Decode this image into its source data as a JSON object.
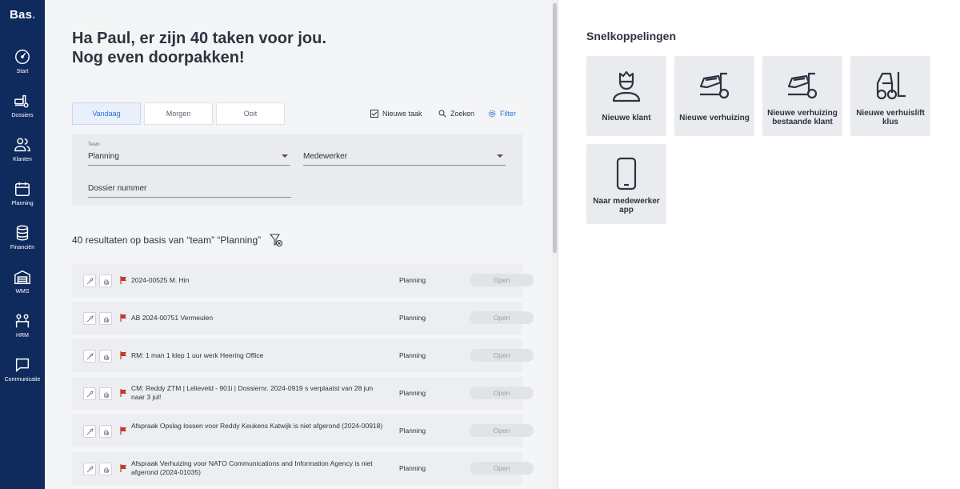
{
  "app": {
    "logo": "Bas",
    "logo_dot": "."
  },
  "sidebar": {
    "items": [
      {
        "label": "Start",
        "icon": "speedometer-icon"
      },
      {
        "label": "Dossiers",
        "icon": "moving-truck-icon"
      },
      {
        "label": "Klanten",
        "icon": "users-icon"
      },
      {
        "label": "Planning",
        "icon": "calendar-icon"
      },
      {
        "label": "Financiën",
        "icon": "coins-icon"
      },
      {
        "label": "WMS",
        "icon": "warehouse-icon"
      },
      {
        "label": "HRM",
        "icon": "people-board-icon"
      },
      {
        "label": "Communicatie",
        "icon": "chat-icon"
      }
    ]
  },
  "main": {
    "greeting_line1": "Ha Paul, er zijn 40 taken voor jou.",
    "greeting_line2": "Nog even doorpakken!",
    "tabs": [
      {
        "label": "Vandaag",
        "active": true
      },
      {
        "label": "Morgen",
        "active": false
      },
      {
        "label": "Ooit",
        "active": false
      }
    ],
    "actions": {
      "new_task": "Nieuwe taak",
      "search": "Zoeken",
      "filter": "Filter"
    },
    "filters": {
      "team_label": "Team",
      "team_value": "Planning",
      "employee_value": "Medewerker",
      "dossier_value": "Dossier nummer"
    },
    "results_text": "40 resultaten op basis van “team” “Planning”",
    "tasks": [
      {
        "description": "2024-00525 M. Hin",
        "team": "Planning",
        "status": "Open"
      },
      {
        "description": "AB 2024-00751 Vermeulen",
        "team": "Planning",
        "status": "Open"
      },
      {
        "description": "RM: 1 man 1 klep 1 uur werk Heering Office",
        "team": "Planning",
        "status": "Open"
      },
      {
        "description": "CM: Reddy ZTM | Lelieveld - 901i | Dossiernr. 2024-0919 s verplaatst van 28 jun naar 3 jul!",
        "team": "Planning",
        "status": "Open"
      },
      {
        "description": "Afspraak Opslag lossen voor Reddy Keukens Katwijk is niet afgerond (2024-00918)",
        "team": "Planning",
        "status": "Open"
      },
      {
        "description": "Afspraak Verhuizing voor NATO Communications and Information Agency is niet afgerond (2024-01035)",
        "team": "Planning",
        "status": "Open"
      }
    ]
  },
  "quick_links": {
    "title": "Snelkoppelingen",
    "items": [
      {
        "label": "Nieuwe klant",
        "icon": "customer-icon"
      },
      {
        "label": "Nieuwe verhuizing",
        "icon": "moving-dolly-icon"
      },
      {
        "label": "Nieuwe verhuizing bestaande klant",
        "icon": "moving-dolly-icon"
      },
      {
        "label": "Nieuwe verhuislift klus",
        "icon": "forklift-icon"
      },
      {
        "label": "Naar medewerker app",
        "icon": "smartphone-icon"
      }
    ]
  },
  "colors": {
    "sidebar": "#0f2a5c",
    "accent": "#2f6fd6",
    "flag": "#c0392b",
    "panel": "#e9ebef"
  }
}
